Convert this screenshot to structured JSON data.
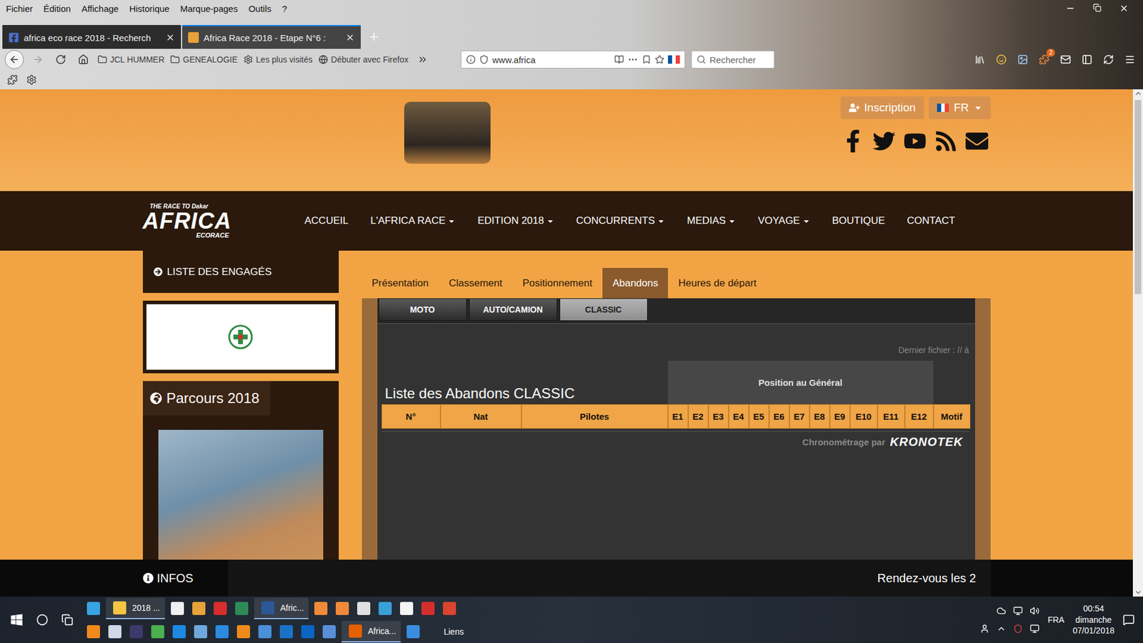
{
  "menubar": [
    "Fichier",
    "Édition",
    "Affichage",
    "Historique",
    "Marque-pages",
    "Outils",
    "?"
  ],
  "tabs": [
    {
      "label": "africa eco race 2018 - Recherch",
      "selected": false
    },
    {
      "label": "Africa Race 2018 - Etape N°6 :",
      "selected": true
    }
  ],
  "toolbar": {
    "bookmarks": [
      "JCL HUMMER",
      "GENEALOGIE",
      "Les plus visités",
      "Débuter avec Firefox"
    ],
    "url": "www.africa",
    "search_placeholder": "Rechercher",
    "badge": "2"
  },
  "page": {
    "header": {
      "signup": "Inscription",
      "language": "FR"
    },
    "logo": {
      "tagline": "THE RACE TO Dakar",
      "name": "AFRICA",
      "sub": "ECORACE"
    },
    "nav": [
      {
        "label": "ACCUEIL",
        "dropdown": false
      },
      {
        "label": "L'AFRICA RACE",
        "dropdown": true
      },
      {
        "label": "EDITION 2018",
        "dropdown": true
      },
      {
        "label": "CONCURRENTS",
        "dropdown": true
      },
      {
        "label": "MEDIAS",
        "dropdown": true
      },
      {
        "label": "VOYAGE",
        "dropdown": true
      },
      {
        "label": "BOUTIQUE",
        "dropdown": false
      },
      {
        "label": "CONTACT",
        "dropdown": false
      }
    ],
    "sidebar": {
      "entrants": "LISTE DES ENGAGÉS",
      "route_title": "Parcours 2018"
    },
    "tabs": [
      {
        "label": "Présentation",
        "selected": false
      },
      {
        "label": "Classement",
        "selected": false
      },
      {
        "label": "Positionnement",
        "selected": false
      },
      {
        "label": "Abandons",
        "selected": true
      },
      {
        "label": "Heures de départ",
        "selected": false
      }
    ],
    "categories": [
      {
        "label": "MOTO",
        "selected": false
      },
      {
        "label": "AUTO/CAMION",
        "selected": false
      },
      {
        "label": "CLASSIC",
        "selected": true
      }
    ],
    "last_file": "Dernier fichier : // à",
    "table_title": "Liste des Abandons CLASSIC",
    "group_header": "Position au Général",
    "columns": [
      "N°",
      "Nat",
      "Pilotes",
      "E1",
      "E2",
      "E3",
      "E4",
      "E5",
      "E6",
      "E7",
      "E8",
      "E9",
      "E10",
      "E11",
      "E12",
      "Motif"
    ],
    "rows": [],
    "timing": {
      "label": "Chronométrage par",
      "brand": "KRONOTEK"
    },
    "scrollbar": {
      "level": 0.4
    }
  },
  "info_bar": {
    "title": "INFOS",
    "ticker": "Rendez-vous les 2"
  },
  "taskbar": {
    "top_row": [
      {
        "label": "2018 ...",
        "active": true
      },
      {
        "label": "Afric...",
        "active": true
      }
    ],
    "bottom_row": [
      {
        "label": "Africa...",
        "active": true
      }
    ],
    "toolbar_label": "Liens",
    "language": "FRA",
    "time": "00:54",
    "day": "dimanche",
    "date": "07/01/2018"
  }
}
